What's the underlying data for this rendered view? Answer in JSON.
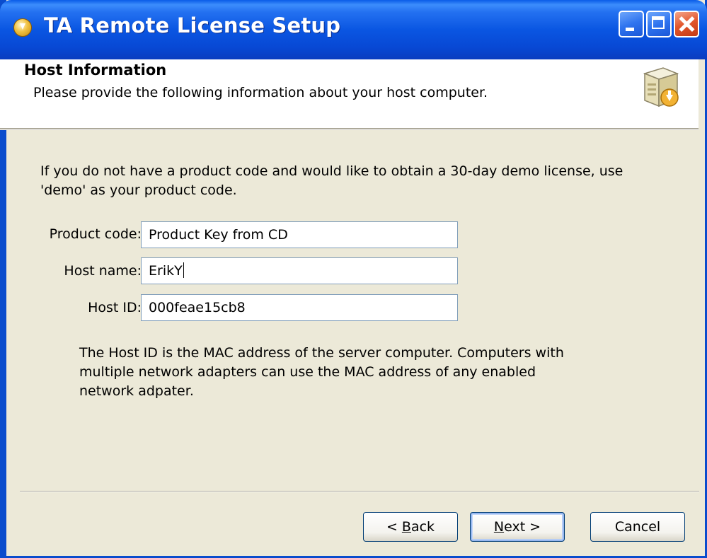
{
  "window": {
    "title": "TA Remote License Setup"
  },
  "header": {
    "title": "Host Information",
    "subtitle": "Please provide the following information about your host computer.",
    "icon": "install-box-icon"
  },
  "intro_text": "If you do not have a product code and would like to obtain a 30-day demo license, use 'demo' as your product code.",
  "form": {
    "product_code": {
      "label": "Product code:",
      "value": "Product Key from CD"
    },
    "host_name": {
      "label": "Host name:",
      "value": "ErikY"
    },
    "host_id": {
      "label": "Host ID:",
      "value": "000feae15cb8"
    }
  },
  "note_text": "The Host ID is the MAC address of the server computer. Computers with multiple network adapters can use the MAC address of any enabled network adpater.",
  "buttons": {
    "back": {
      "prefix": "< ",
      "mnemonic": "B",
      "rest": "ack"
    },
    "next": {
      "mnemonic": "N",
      "rest": "ext >"
    },
    "cancel": "Cancel"
  }
}
